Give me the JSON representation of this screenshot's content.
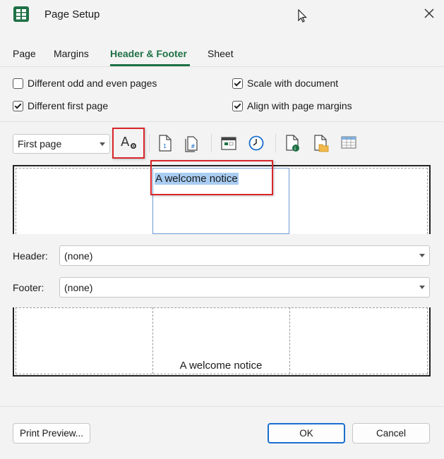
{
  "window": {
    "title": "Page Setup"
  },
  "tabs": [
    {
      "label": "Page"
    },
    {
      "label": "Margins"
    },
    {
      "label": "Header & Footer",
      "active": true
    },
    {
      "label": "Sheet"
    }
  ],
  "options": {
    "odd_even": {
      "label": "Different odd and even pages",
      "checked": false
    },
    "first_page": {
      "label": "Different first page",
      "checked": true
    },
    "scale_doc": {
      "label": "Scale with document",
      "checked": true
    },
    "align_margins": {
      "label": "Align with page margins",
      "checked": true
    }
  },
  "toolbar": {
    "page_select": "First page",
    "icons": [
      "format-text-icon",
      "page-number-icon",
      "page-count-icon",
      "date-icon",
      "time-icon",
      "file-path-icon",
      "file-name-icon",
      "sheet-name-icon"
    ]
  },
  "header_preview": {
    "center_text": "A welcome notice"
  },
  "header": {
    "label": "Header:",
    "value": "(none)"
  },
  "footer": {
    "label": "Footer:",
    "value": "(none)"
  },
  "footer_preview": {
    "center_text": "A welcome notice"
  },
  "buttons": {
    "print_preview": "Print Preview...",
    "ok": "OK",
    "cancel": "Cancel"
  },
  "colors": {
    "accent": "#1e7145",
    "highlight_box": "#d9262b",
    "selection": "#a9cdf2",
    "primary_border": "#1a6fcf"
  }
}
